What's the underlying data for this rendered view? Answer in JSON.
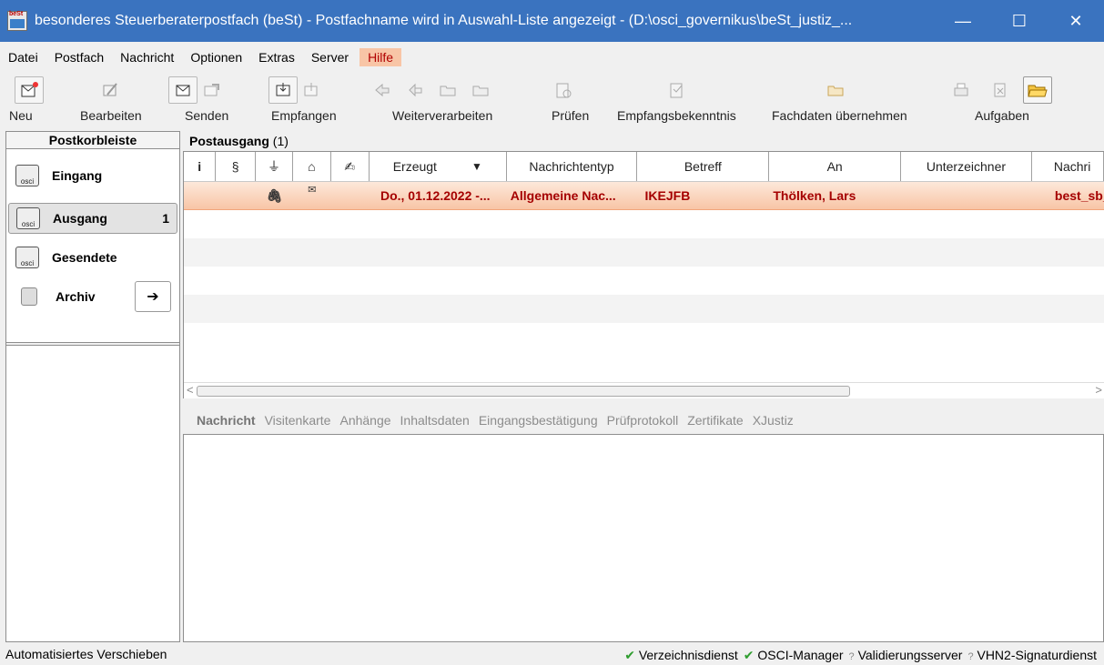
{
  "window": {
    "title": "besonderes Steuerberaterpostfach (beSt) - Postfachname wird in Auswahl-Liste angezeigt - (D:\\osci_governikus\\beSt_justiz_...",
    "minimize": "—",
    "maximize": "☐",
    "close": "✕"
  },
  "menu": [
    "Datei",
    "Postfach",
    "Nachricht",
    "Optionen",
    "Extras",
    "Server",
    "Hilfe"
  ],
  "toolbar": {
    "labels": {
      "neu": "Neu",
      "bearbeiten": "Bearbeiten",
      "senden": "Senden",
      "empfangen": "Empfangen",
      "weiterverarbeiten": "Weiterverarbeiten",
      "pruefen": "Prüfen",
      "empfangsbekenntnis": "Empfangsbekenntnis",
      "fachdaten": "Fachdaten übernehmen",
      "aufgaben": "Aufgaben"
    }
  },
  "sidebar": {
    "header": "Postkorbleiste",
    "items": [
      {
        "label": "Eingang",
        "count": "",
        "icon": "inbox-tray-icon"
      },
      {
        "label": "Ausgang",
        "count": "1",
        "icon": "outbox-tray-icon"
      },
      {
        "label": "Gesendete",
        "count": "",
        "icon": "sent-tray-icon"
      },
      {
        "label": "Archiv",
        "count": "",
        "icon": "archive-icon"
      }
    ],
    "archive_arrow": "➔",
    "tray_text": "osci"
  },
  "main": {
    "folder_title": "Postausgang",
    "folder_count": "(1)",
    "columns": [
      "i",
      "§",
      "📎",
      "⌂",
      "✍",
      "Erzeugt",
      "▼",
      "Nachrichtentyp",
      "Betreff",
      "An",
      "Unterzeichner",
      "Nachri"
    ],
    "rows": [
      {
        "attachment": "🖇",
        "mail": "✉",
        "erzeugt": "Do., 01.12.2022 -...",
        "typ": "Allgemeine Nac...",
        "betreff": "IKEJFB",
        "an": "Thölken, Lars",
        "unterzeichner": "",
        "nachricht": "best_sb_"
      }
    ],
    "scroll_left": "<",
    "scroll_right": ">"
  },
  "detail_tabs": [
    "Nachricht",
    "Visitenkarte",
    "Anhänge",
    "Inhaltsdaten",
    "Eingangsbestätigung",
    "Prüfprotokoll",
    "Zertifikate",
    "XJustiz"
  ],
  "status": {
    "left": "Automatisiertes Verschieben",
    "services": [
      {
        "mark": "✔",
        "name": "Verzeichnisdienst",
        "state": "ok"
      },
      {
        "mark": "✔",
        "name": "OSCI-Manager",
        "state": "ok"
      },
      {
        "mark": "?",
        "name": "Validierungsserver",
        "state": "pending"
      },
      {
        "mark": "?",
        "name": "VHN2-Signaturdienst",
        "state": "pending"
      }
    ]
  },
  "colors": {
    "titlebar": "#3a73bf",
    "selection_row": "#f8c5a6",
    "selection_text": "#a50000",
    "ok_check": "#2e9d2e"
  }
}
